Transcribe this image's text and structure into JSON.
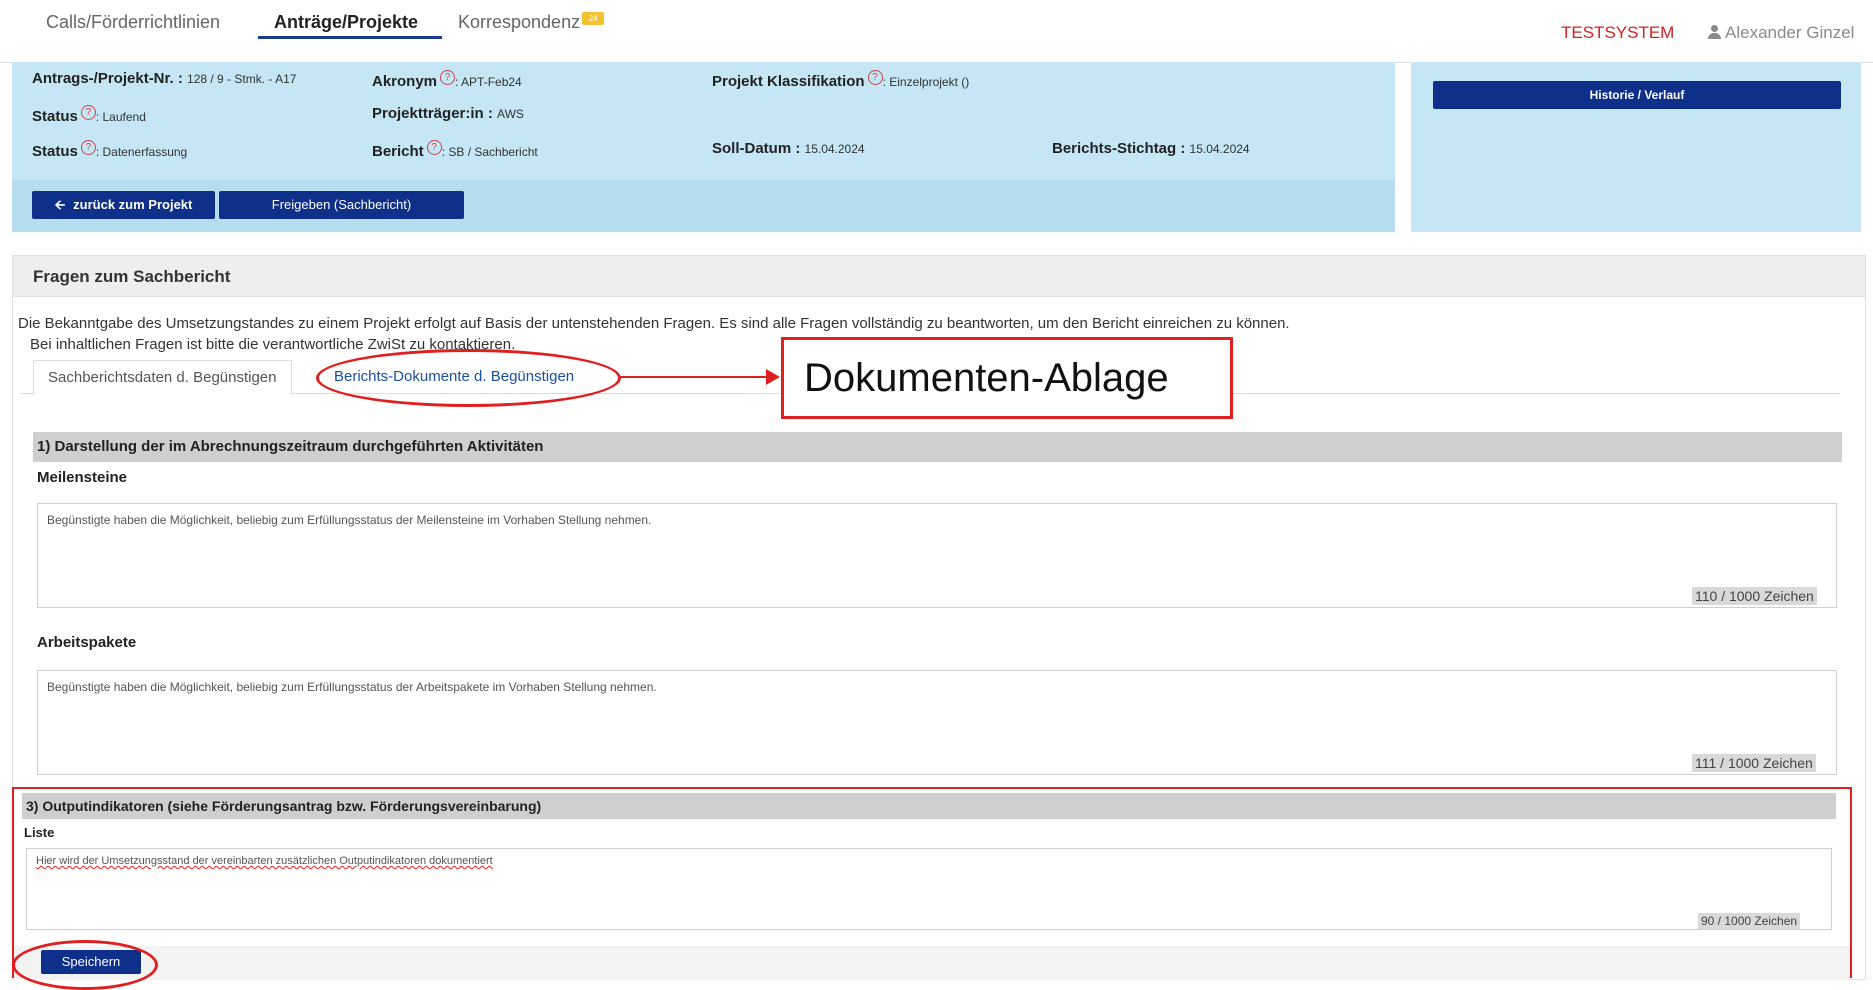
{
  "nav": {
    "tabs": [
      {
        "label": "Calls/Förderrichtlinien"
      },
      {
        "label": "Anträge/Projekte"
      },
      {
        "label": "Korrespondenz"
      }
    ],
    "badge": "24",
    "testsystem": "TESTSYSTEM",
    "user": "Alexander Ginzel"
  },
  "project": {
    "nr_label": "Antrags-/Projekt-Nr. :",
    "nr_value": "128 / 9 - Stmk. - A17",
    "akronym_label": "Akronym",
    "akronym_value": ": APT-Feb24",
    "klass_label": "Projekt Klassifikation",
    "klass_value": ": Einzelprojekt ()",
    "status1_label": "Status",
    "status1_value": ": Laufend",
    "traeger_label": "Projektträger:in :",
    "traeger_value": "AWS",
    "status2_label": "Status",
    "status2_value": ": Datenerfassung",
    "bericht_label": "Bericht",
    "bericht_value": ": SB / Sachbericht",
    "soll_label": "Soll-Datum :",
    "soll_value": "15.04.2024",
    "stichtag_label": "Berichts-Stichtag :",
    "stichtag_value": "15.04.2024",
    "help_glyph": "?"
  },
  "buttons": {
    "back": "zurück zum Projekt",
    "release": "Freigeben (Sachbericht)",
    "history": "Historie / Verlauf",
    "save": "Speichern"
  },
  "section": {
    "title": "Fragen zum Sachbericht",
    "intro1": "Die Bekanntgabe des Umsetzungstandes zu einem Projekt erfolgt auf Basis der untenstehenden Fragen. Es sind alle Fragen vollständig zu beantworten, um den Bericht einreichen zu können.",
    "intro2": "Bei inhaltlichen Fragen ist bitte die verantwortliche ZwiSt zu kontaktieren.",
    "tab1": "Sachberichtsdaten d. Begünstigen",
    "tab2": "Berichts-Dokumente d. Begünstigen"
  },
  "annotation": {
    "label": "Dokumenten-Ablage"
  },
  "q1": {
    "title": "1) Darstellung der im Abrechnungszeitraum durchgeführten Aktivitäten",
    "f1_label": "Meilensteine",
    "f1_text": "Begünstigte haben die Möglichkeit, beliebig zum Erfüllungsstatus der Meilensteine im Vorhaben Stellung nehmen.",
    "f1_count": "110 / 1000 Zeichen",
    "f2_label": "Arbeitspakete",
    "f2_text": "Begünstigte haben die Möglichkeit, beliebig zum Erfüllungsstatus der Arbeitspakete im Vorhaben Stellung nehmen.",
    "f2_count": "111 / 1000 Zeichen"
  },
  "q3": {
    "title": "3) Outputindikatoren (siehe Förderungsantrag bzw. Förderungsvereinbarung)",
    "f_label": "Liste",
    "f_text": "Hier wird der Umsetzungsstand der vereinbarten zusätzlichen Outputindikatoren dokumentiert",
    "f_count": "90 / 1000 Zeichen"
  },
  "colors": {
    "navy": "#0e2f8a",
    "panel": "#c4e6f5",
    "annotation_red": "#e02020"
  }
}
